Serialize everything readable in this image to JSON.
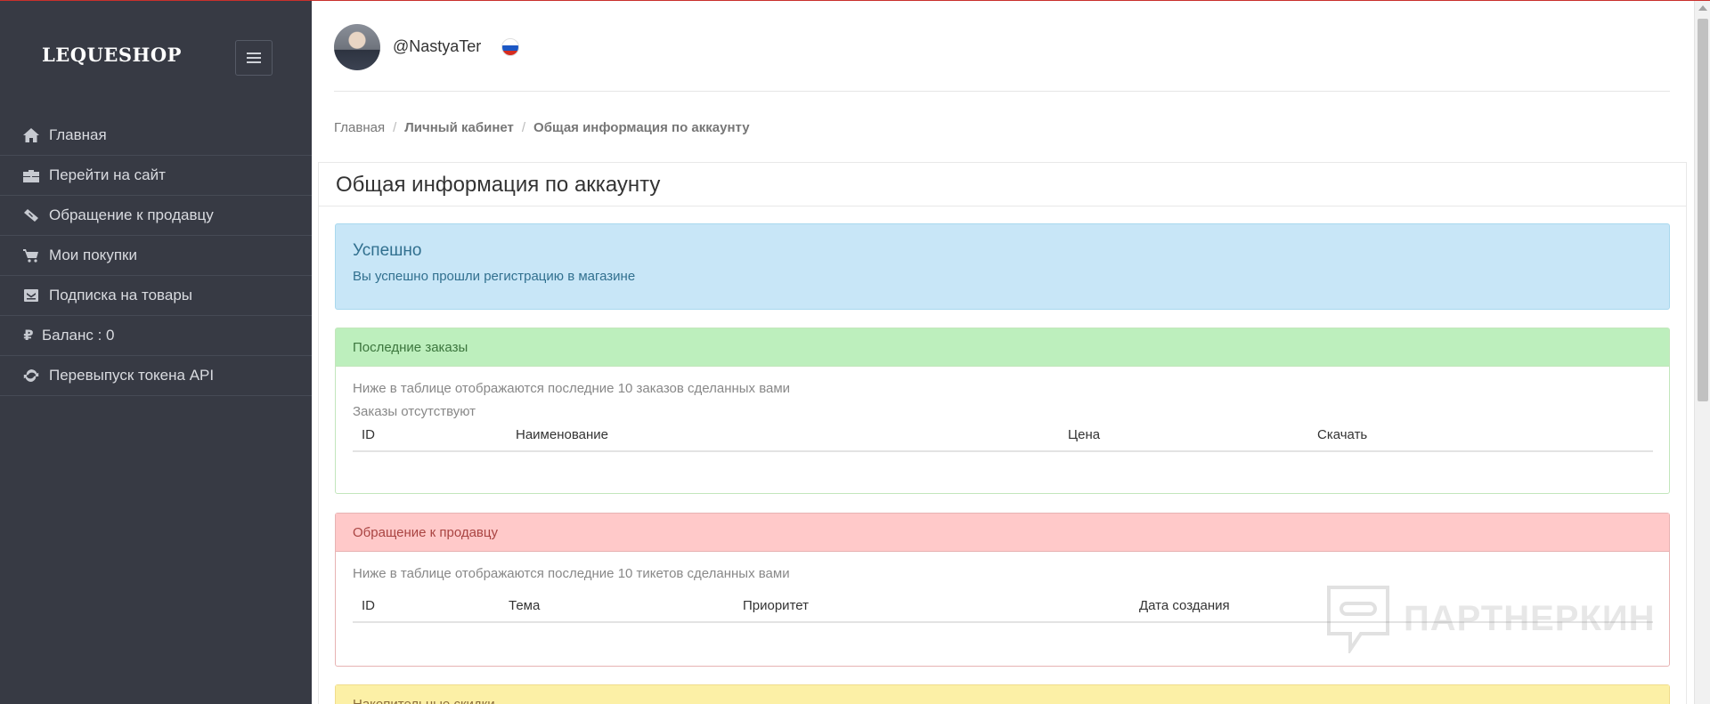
{
  "sidebar": {
    "brand": "LEQUESHOP",
    "items": [
      {
        "label": "Главная",
        "icon": "home-icon"
      },
      {
        "label": "Перейти на сайт",
        "icon": "briefcase-icon"
      },
      {
        "label": "Обращение к продавцу",
        "icon": "ticket-icon"
      },
      {
        "label": "Мои покупки",
        "icon": "cart-icon"
      },
      {
        "label": "Подписка на товары",
        "icon": "envelope-icon"
      },
      {
        "label": "Баланс : 0",
        "icon": "ruble-icon"
      },
      {
        "label": "Перевыпуск токена API",
        "icon": "refresh-icon"
      }
    ]
  },
  "header": {
    "username": "@NastyaTer"
  },
  "breadcrumb": {
    "home": "Главная",
    "cabinet": "Личный кабинет",
    "current": "Общая информация по аккаунту"
  },
  "page_title": "Общая информация по аккаунту",
  "alert": {
    "title": "Успешно",
    "text": "Вы успешно прошли регистрацию в магазине"
  },
  "orders": {
    "title": "Последние заказы",
    "description": "Ниже в таблице отображаются последние 10 заказов сделанных вами",
    "empty": "Заказы отсутствуют",
    "columns": [
      "ID",
      "Наименование",
      "Цена",
      "Скачать"
    ]
  },
  "tickets": {
    "title": "Обращение к продавцу",
    "description": "Ниже в таблице отображаются последние 10 тикетов сделанных вами",
    "columns": [
      "ID",
      "Тема",
      "Приоритет",
      "Дата создания"
    ]
  },
  "discounts": {
    "title": "Накопительные скидки"
  },
  "watermark": "ПАРТНЕРКИН",
  "colors": {
    "sidebar_bg": "#373a44",
    "alert_bg": "#c8e6f7",
    "success_head": "#bdefbd",
    "danger_head": "#ffc9c9",
    "warning_head": "#fcf0a6"
  }
}
